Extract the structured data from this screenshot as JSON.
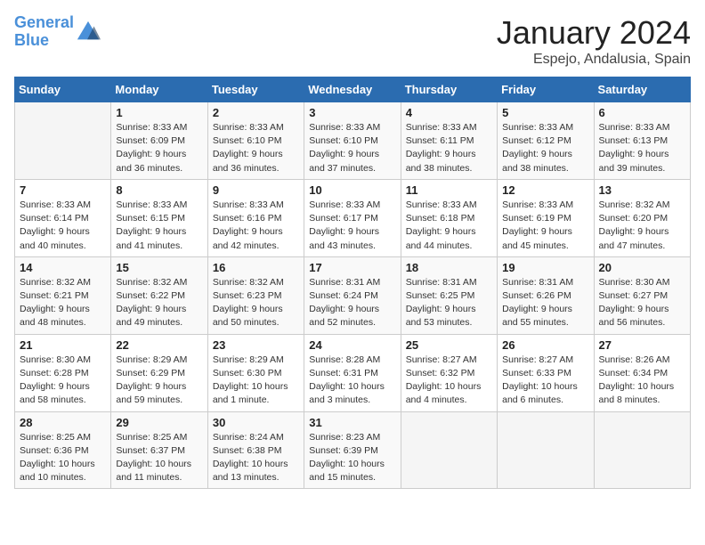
{
  "logo": {
    "line1": "General",
    "line2": "Blue"
  },
  "title": "January 2024",
  "subtitle": "Espejo, Andalusia, Spain",
  "days_of_week": [
    "Sunday",
    "Monday",
    "Tuesday",
    "Wednesday",
    "Thursday",
    "Friday",
    "Saturday"
  ],
  "weeks": [
    [
      {
        "day": "",
        "sunrise": "",
        "sunset": "",
        "daylight": ""
      },
      {
        "day": "1",
        "sunrise": "Sunrise: 8:33 AM",
        "sunset": "Sunset: 6:09 PM",
        "daylight": "Daylight: 9 hours and 36 minutes."
      },
      {
        "day": "2",
        "sunrise": "Sunrise: 8:33 AM",
        "sunset": "Sunset: 6:10 PM",
        "daylight": "Daylight: 9 hours and 36 minutes."
      },
      {
        "day": "3",
        "sunrise": "Sunrise: 8:33 AM",
        "sunset": "Sunset: 6:10 PM",
        "daylight": "Daylight: 9 hours and 37 minutes."
      },
      {
        "day": "4",
        "sunrise": "Sunrise: 8:33 AM",
        "sunset": "Sunset: 6:11 PM",
        "daylight": "Daylight: 9 hours and 38 minutes."
      },
      {
        "day": "5",
        "sunrise": "Sunrise: 8:33 AM",
        "sunset": "Sunset: 6:12 PM",
        "daylight": "Daylight: 9 hours and 38 minutes."
      },
      {
        "day": "6",
        "sunrise": "Sunrise: 8:33 AM",
        "sunset": "Sunset: 6:13 PM",
        "daylight": "Daylight: 9 hours and 39 minutes."
      }
    ],
    [
      {
        "day": "7",
        "sunrise": "Sunrise: 8:33 AM",
        "sunset": "Sunset: 6:14 PM",
        "daylight": "Daylight: 9 hours and 40 minutes."
      },
      {
        "day": "8",
        "sunrise": "Sunrise: 8:33 AM",
        "sunset": "Sunset: 6:15 PM",
        "daylight": "Daylight: 9 hours and 41 minutes."
      },
      {
        "day": "9",
        "sunrise": "Sunrise: 8:33 AM",
        "sunset": "Sunset: 6:16 PM",
        "daylight": "Daylight: 9 hours and 42 minutes."
      },
      {
        "day": "10",
        "sunrise": "Sunrise: 8:33 AM",
        "sunset": "Sunset: 6:17 PM",
        "daylight": "Daylight: 9 hours and 43 minutes."
      },
      {
        "day": "11",
        "sunrise": "Sunrise: 8:33 AM",
        "sunset": "Sunset: 6:18 PM",
        "daylight": "Daylight: 9 hours and 44 minutes."
      },
      {
        "day": "12",
        "sunrise": "Sunrise: 8:33 AM",
        "sunset": "Sunset: 6:19 PM",
        "daylight": "Daylight: 9 hours and 45 minutes."
      },
      {
        "day": "13",
        "sunrise": "Sunrise: 8:32 AM",
        "sunset": "Sunset: 6:20 PM",
        "daylight": "Daylight: 9 hours and 47 minutes."
      }
    ],
    [
      {
        "day": "14",
        "sunrise": "Sunrise: 8:32 AM",
        "sunset": "Sunset: 6:21 PM",
        "daylight": "Daylight: 9 hours and 48 minutes."
      },
      {
        "day": "15",
        "sunrise": "Sunrise: 8:32 AM",
        "sunset": "Sunset: 6:22 PM",
        "daylight": "Daylight: 9 hours and 49 minutes."
      },
      {
        "day": "16",
        "sunrise": "Sunrise: 8:32 AM",
        "sunset": "Sunset: 6:23 PM",
        "daylight": "Daylight: 9 hours and 50 minutes."
      },
      {
        "day": "17",
        "sunrise": "Sunrise: 8:31 AM",
        "sunset": "Sunset: 6:24 PM",
        "daylight": "Daylight: 9 hours and 52 minutes."
      },
      {
        "day": "18",
        "sunrise": "Sunrise: 8:31 AM",
        "sunset": "Sunset: 6:25 PM",
        "daylight": "Daylight: 9 hours and 53 minutes."
      },
      {
        "day": "19",
        "sunrise": "Sunrise: 8:31 AM",
        "sunset": "Sunset: 6:26 PM",
        "daylight": "Daylight: 9 hours and 55 minutes."
      },
      {
        "day": "20",
        "sunrise": "Sunrise: 8:30 AM",
        "sunset": "Sunset: 6:27 PM",
        "daylight": "Daylight: 9 hours and 56 minutes."
      }
    ],
    [
      {
        "day": "21",
        "sunrise": "Sunrise: 8:30 AM",
        "sunset": "Sunset: 6:28 PM",
        "daylight": "Daylight: 9 hours and 58 minutes."
      },
      {
        "day": "22",
        "sunrise": "Sunrise: 8:29 AM",
        "sunset": "Sunset: 6:29 PM",
        "daylight": "Daylight: 9 hours and 59 minutes."
      },
      {
        "day": "23",
        "sunrise": "Sunrise: 8:29 AM",
        "sunset": "Sunset: 6:30 PM",
        "daylight": "Daylight: 10 hours and 1 minute."
      },
      {
        "day": "24",
        "sunrise": "Sunrise: 8:28 AM",
        "sunset": "Sunset: 6:31 PM",
        "daylight": "Daylight: 10 hours and 3 minutes."
      },
      {
        "day": "25",
        "sunrise": "Sunrise: 8:27 AM",
        "sunset": "Sunset: 6:32 PM",
        "daylight": "Daylight: 10 hours and 4 minutes."
      },
      {
        "day": "26",
        "sunrise": "Sunrise: 8:27 AM",
        "sunset": "Sunset: 6:33 PM",
        "daylight": "Daylight: 10 hours and 6 minutes."
      },
      {
        "day": "27",
        "sunrise": "Sunrise: 8:26 AM",
        "sunset": "Sunset: 6:34 PM",
        "daylight": "Daylight: 10 hours and 8 minutes."
      }
    ],
    [
      {
        "day": "28",
        "sunrise": "Sunrise: 8:25 AM",
        "sunset": "Sunset: 6:36 PM",
        "daylight": "Daylight: 10 hours and 10 minutes."
      },
      {
        "day": "29",
        "sunrise": "Sunrise: 8:25 AM",
        "sunset": "Sunset: 6:37 PM",
        "daylight": "Daylight: 10 hours and 11 minutes."
      },
      {
        "day": "30",
        "sunrise": "Sunrise: 8:24 AM",
        "sunset": "Sunset: 6:38 PM",
        "daylight": "Daylight: 10 hours and 13 minutes."
      },
      {
        "day": "31",
        "sunrise": "Sunrise: 8:23 AM",
        "sunset": "Sunset: 6:39 PM",
        "daylight": "Daylight: 10 hours and 15 minutes."
      },
      {
        "day": "",
        "sunrise": "",
        "sunset": "",
        "daylight": ""
      },
      {
        "day": "",
        "sunrise": "",
        "sunset": "",
        "daylight": ""
      },
      {
        "day": "",
        "sunrise": "",
        "sunset": "",
        "daylight": ""
      }
    ]
  ]
}
